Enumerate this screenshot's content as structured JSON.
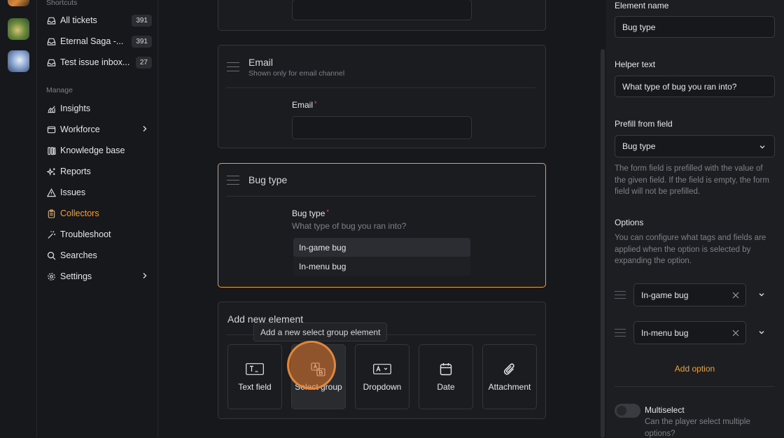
{
  "sidebar": {
    "shortcuts_label": "Shortcuts",
    "shortcuts": [
      {
        "label": "All tickets",
        "count": "391"
      },
      {
        "label": "Eternal Saga -...",
        "count": "391"
      },
      {
        "label": "Test issue inbox...",
        "count": "27"
      }
    ],
    "manage_label": "Manage",
    "manage": [
      {
        "label": "Insights",
        "icon": "chart-icon"
      },
      {
        "label": "Workforce",
        "icon": "workforce-icon"
      },
      {
        "label": "Knowledge base",
        "icon": "library-icon"
      },
      {
        "label": "Reports",
        "icon": "sparkle-icon"
      },
      {
        "label": "Issues",
        "icon": "warning-icon"
      },
      {
        "label": "Collectors",
        "icon": "clipboard-icon"
      },
      {
        "label": "Troubleshoot",
        "icon": "wand-icon"
      },
      {
        "label": "Searches",
        "icon": "search-icon"
      },
      {
        "label": "Settings",
        "icon": "gear-icon"
      }
    ]
  },
  "form": {
    "email_card": {
      "title": "Email",
      "subtitle": "Shown only for email channel",
      "field_label": "Email",
      "required_mark": "*"
    },
    "bug_card": {
      "title": "Bug type",
      "field_label": "Bug type",
      "required_mark": "*",
      "helper": "What type of bug you ran into?",
      "options": [
        "In-game bug",
        "In-menu bug"
      ]
    },
    "add_card": {
      "title": "Add new element",
      "tooltip": "Add a new select group element",
      "elements": [
        {
          "label": "Text field",
          "icon": "text-field-icon"
        },
        {
          "label": "Select group",
          "icon": "select-group-icon"
        },
        {
          "label": "Dropdown",
          "icon": "dropdown-icon"
        },
        {
          "label": "Date",
          "icon": "calendar-icon"
        },
        {
          "label": "Attachment",
          "icon": "paperclip-icon"
        }
      ]
    }
  },
  "panel": {
    "element_name_label": "Element name",
    "element_name_value": "Bug type",
    "helper_text_label": "Helper text",
    "helper_text_value": "What type of bug you ran into?",
    "prefill_label": "Prefill from field",
    "prefill_value": "Bug type",
    "prefill_help": "The form field is prefilled with the value of the given field. If the field is empty, the form field will not be prefilled.",
    "options_label": "Options",
    "options_help": "You can configure what tags and fields are applied when the option is selected by expanding the option.",
    "options": [
      "In-game bug",
      "In-menu bug"
    ],
    "add_option": "Add option",
    "multiselect_label": "Multiselect",
    "multiselect_help": "Can the player select multiple options?"
  },
  "colors": {
    "accent": "#e9a23b",
    "background": "#17181b",
    "panel": "#1d1e22"
  }
}
